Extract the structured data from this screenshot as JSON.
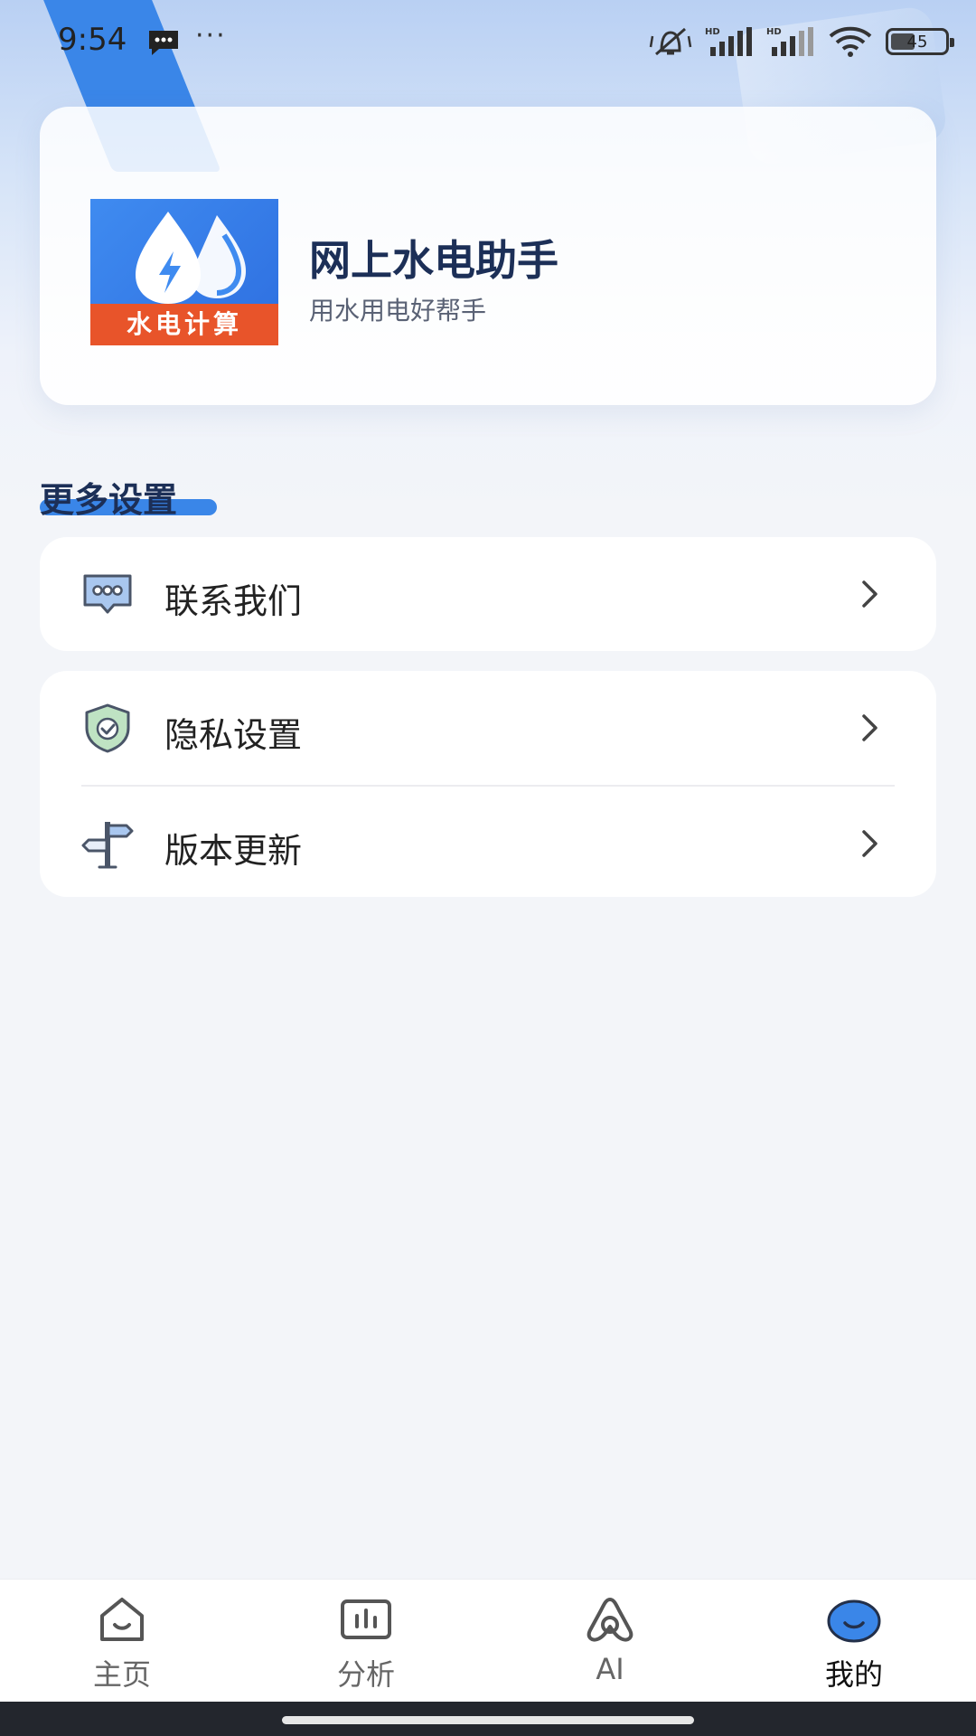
{
  "status_bar": {
    "time": "9:54",
    "more": "···",
    "battery": "45",
    "icons": [
      "message-icon",
      "mute-icon",
      "hd-signal-icon",
      "hd-signal-icon",
      "wifi-icon",
      "battery-icon"
    ]
  },
  "app": {
    "logo_text": "水电计算",
    "name": "网上水电助手",
    "tagline": "用水用电好帮手"
  },
  "section": {
    "title": "更多设置"
  },
  "menu": {
    "contact": {
      "label": "联系我们",
      "icon": "chat-bubble-icon"
    },
    "privacy": {
      "label": "隐私设置",
      "icon": "shield-check-icon"
    },
    "update": {
      "label": "版本更新",
      "icon": "signpost-icon"
    }
  },
  "bottom_nav": {
    "items": [
      {
        "label": "主页",
        "icon": "home-icon"
      },
      {
        "label": "分析",
        "icon": "chart-icon"
      },
      {
        "label": "AI",
        "icon": "ai-icon"
      },
      {
        "label": "我的",
        "icon": "profile-icon",
        "active": true
      }
    ]
  },
  "colors": {
    "accent": "#3a86e8",
    "title": "#1c2f57",
    "logo_strip": "#e8542a",
    "background": "#f3f5f9"
  }
}
